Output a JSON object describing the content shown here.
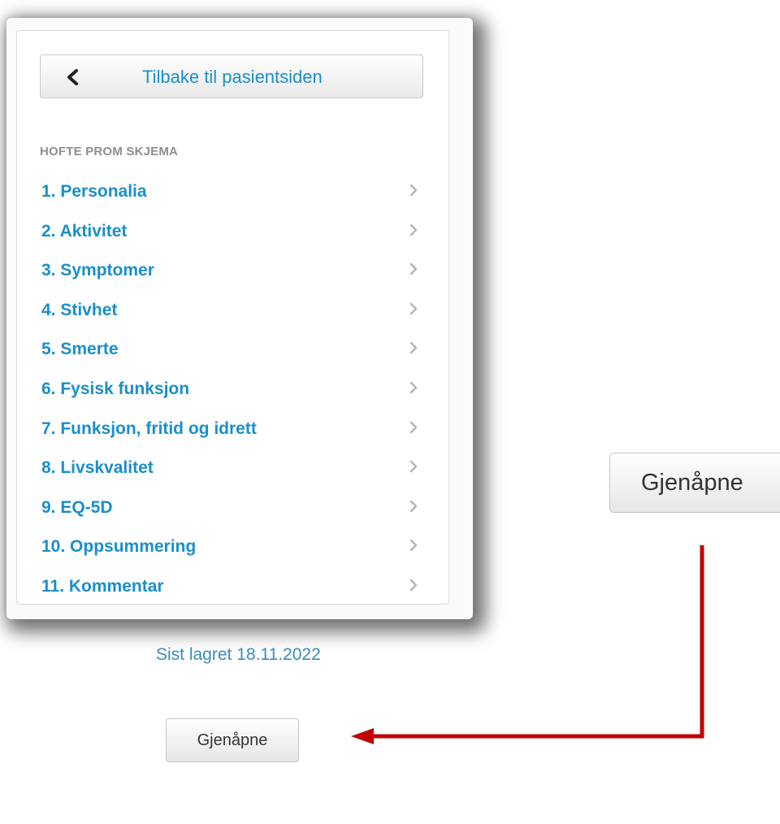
{
  "back_button": {
    "label": "Tilbake til pasientsiden"
  },
  "form": {
    "section_title": "HOFTE PROM SKJEMA",
    "items": [
      {
        "label": "1. Personalia"
      },
      {
        "label": "2. Aktivitet"
      },
      {
        "label": "3. Symptomer"
      },
      {
        "label": "4. Stivhet"
      },
      {
        "label": "5. Smerte"
      },
      {
        "label": "6. Fysisk funksjon"
      },
      {
        "label": "7. Funksjon, fritid og idrett"
      },
      {
        "label": "8. Livskvalitet"
      },
      {
        "label": "9. EQ-5D"
      },
      {
        "label": "10. Oppsummering"
      },
      {
        "label": "11. Kommentar"
      }
    ],
    "saved_status": "Sist lagret 18.11.2022",
    "reopen_label": "Gjenåpne"
  },
  "callout": {
    "reopen_label": "Gjenåpne",
    "arrow_color": "#c00000"
  },
  "colors": {
    "link": "#1a8fc9",
    "section_title": "#8e8e8e",
    "saved_status": "#3b8bb8"
  }
}
